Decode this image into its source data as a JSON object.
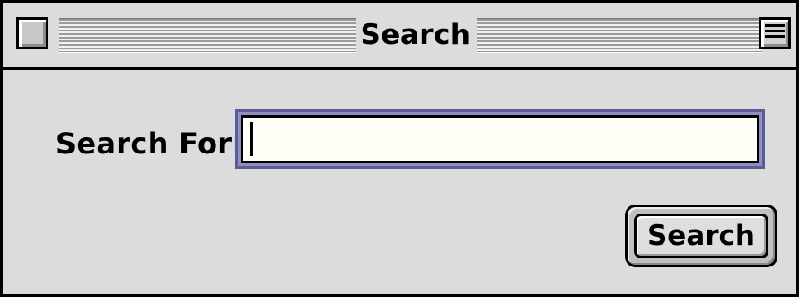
{
  "window": {
    "title": "Search"
  },
  "form": {
    "label": "Search For:",
    "input_value": "",
    "button_label": "Search"
  },
  "icons": {
    "close": "close-box-icon",
    "zoom": "zoom-box-icon"
  }
}
